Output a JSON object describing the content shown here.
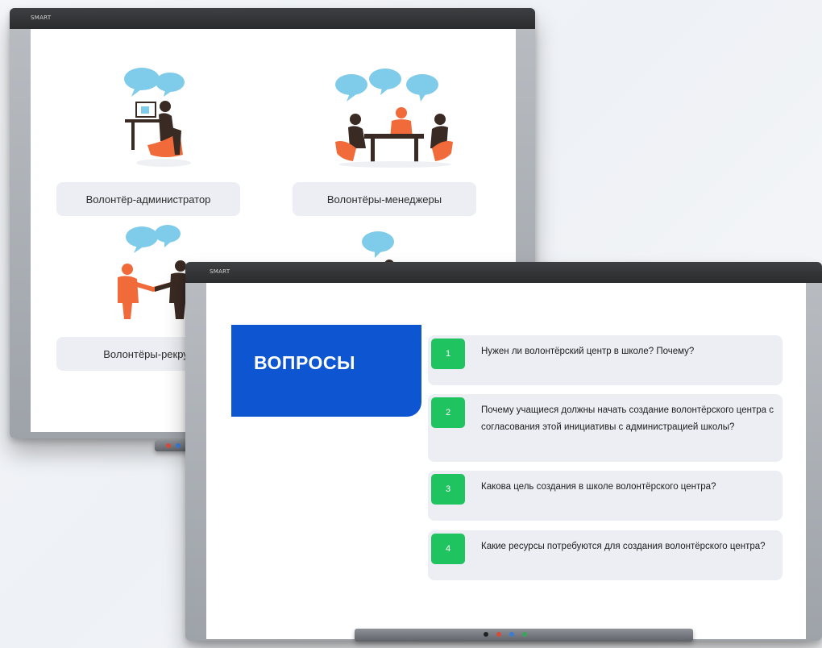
{
  "back_board": {
    "brand": "SMART",
    "roles": [
      {
        "label": "Волонтёр-администратор",
        "icon": "volunteer-at-computer-icon"
      },
      {
        "label": "Волонтёры-менеджеры",
        "icon": "meeting-at-table-icon"
      },
      {
        "label": "Волонтёры-рекрут",
        "icon": "handshake-icon"
      },
      {
        "label": "",
        "icon": "person-with-speech-bubble-icon"
      }
    ]
  },
  "front_board": {
    "brand": "SMART",
    "title": "ВОПРОСЫ",
    "questions": [
      {
        "number": "1",
        "text": "Нужен ли волонтёрский центр в школе? Почему?"
      },
      {
        "number": "2",
        "text": "Почему учащиеся должны начать создание волонтёрского центра с согласования этой инициативы с администрацией школы?"
      },
      {
        "number": "3",
        "text": "Какова цель создания в школе волонтёрского центра?"
      },
      {
        "number": "4",
        "text": "Какие ресурсы потребуются для создания волонтёрского центра?"
      }
    ]
  },
  "colors": {
    "title_blue": "#0e55d2",
    "number_green": "#1fc35f",
    "bubble_blue": "#7fcbea",
    "figure_brown": "#3a2a24",
    "figure_orange": "#f06a3a",
    "card_gray": "#eceef3"
  }
}
